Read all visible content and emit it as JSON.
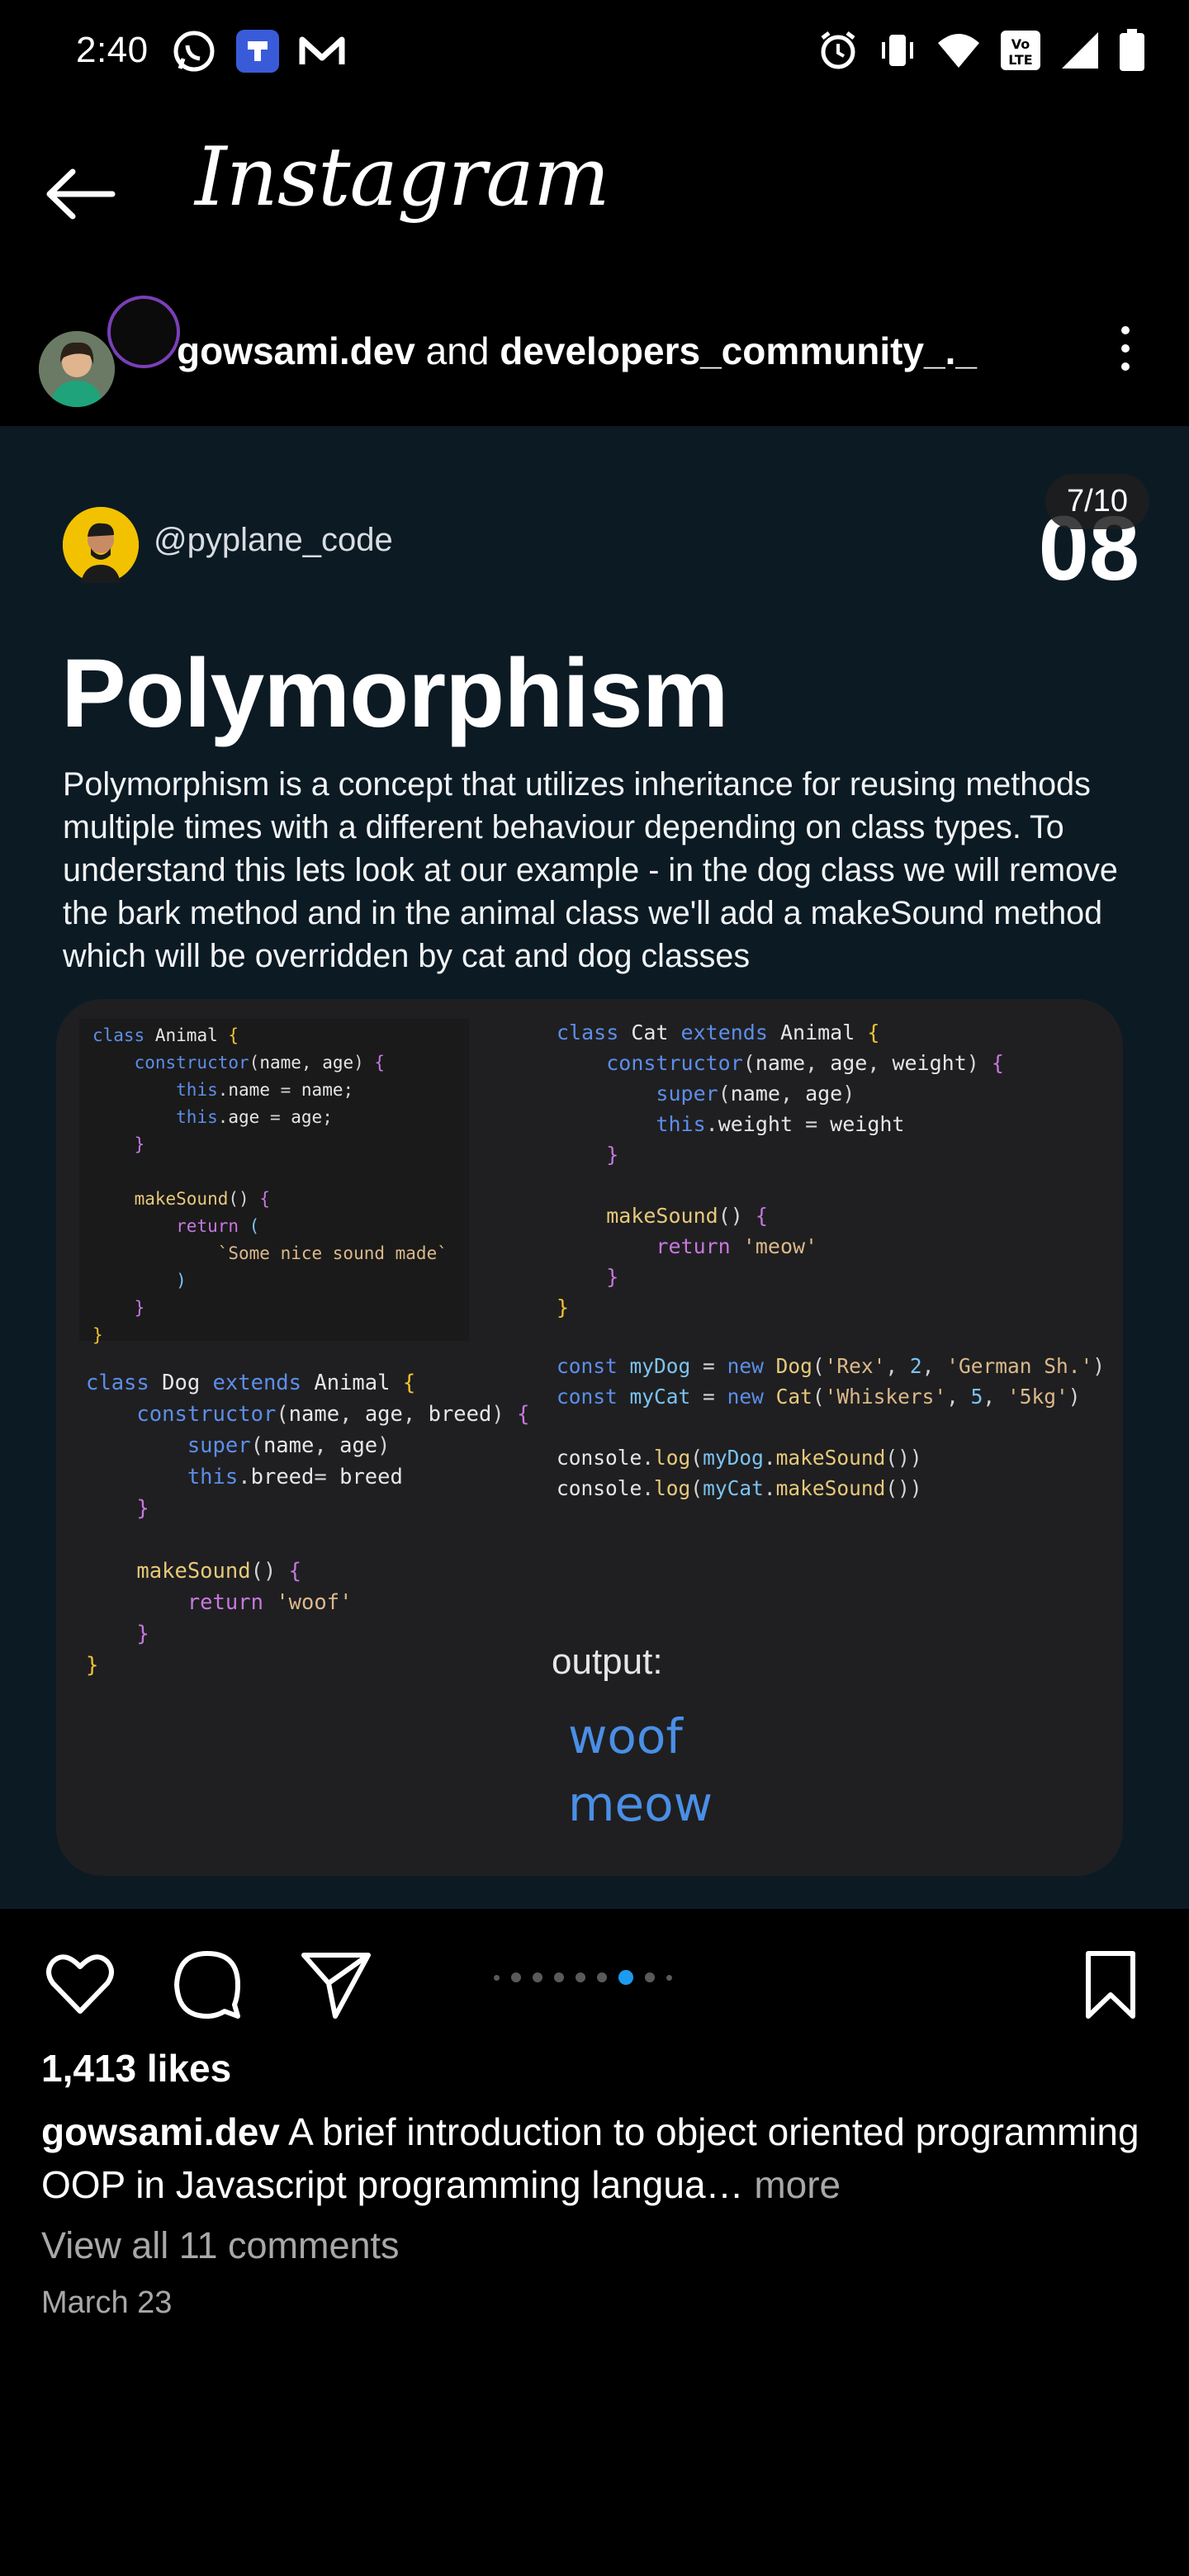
{
  "status_bar": {
    "time": "2:40",
    "left_icons": [
      "whatsapp-icon",
      "app-icon",
      "gmail-icon"
    ],
    "right_icons": [
      "alarm-icon",
      "vibrate-icon",
      "wifi-icon",
      "volte-icon",
      "signal-icon",
      "battery-icon"
    ]
  },
  "top_bar": {
    "brand": "Instagram"
  },
  "post_header": {
    "author_1": "gowsami.dev",
    "connector": " and ",
    "author_2": "developers_community_._"
  },
  "media": {
    "counter": "7/10",
    "creator_handle": "@pyplane_code",
    "slide_number": "08",
    "title": "Polymorphism",
    "body": "Polymorphism is a concept that utilizes inheritance for reusing methods multiple times with a different behaviour depending on class types. To understand this lets look at our example - in  the dog class we will remove the bark method and in  the animal  class we'll add a makeSound method which will be overridden  by cat and dog classes",
    "output_label": "output:",
    "output_1": "woof",
    "output_2": "meow"
  },
  "carousel": {
    "total": 9,
    "active_index": 6
  },
  "post_footer": {
    "likes": "1,413 likes",
    "caption_author": "gowsami.dev",
    "caption_text": "A brief introduction to object oriented programming OOP in Javascript programming langua…",
    "more": "more",
    "view_comments": "View all 11 comments",
    "date": "March 23"
  }
}
